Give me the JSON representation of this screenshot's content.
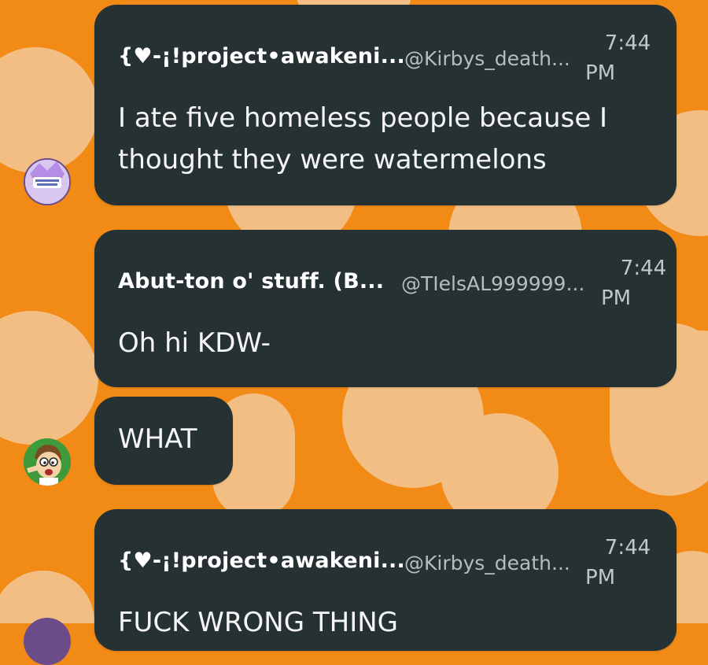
{
  "messages": [
    {
      "display_name": "{♥-¡!project•awakeni...",
      "handle": "@Kirbys_death...",
      "time_top": "7:44",
      "time_bottom": "PM",
      "text": "I ate five homeless people because I thought they were watermelons"
    },
    {
      "display_name": "Abut-ton o' stuff. (B...",
      "handle": "@TIelsAL999999...",
      "time_top": "7:44",
      "time_bottom": "PM",
      "text": "Oh hi KDW-"
    },
    {
      "text": "WHAT"
    },
    {
      "display_name": "{♥-¡!project•awakeni...",
      "handle": "@Kirbys_death...",
      "time_top": "7:44",
      "time_bottom": "PM",
      "text": "FUCK WRONG THING"
    }
  ],
  "colors": {
    "background": "#f28a16",
    "background_pattern": "#f2be84",
    "bubble": "#263133",
    "text": "#ffffff",
    "muted_text": "#b7bdbd"
  },
  "icons": {
    "avatar_1": "project-awakening-logo-avatar",
    "avatar_2": "cartoon-character-avatar"
  }
}
